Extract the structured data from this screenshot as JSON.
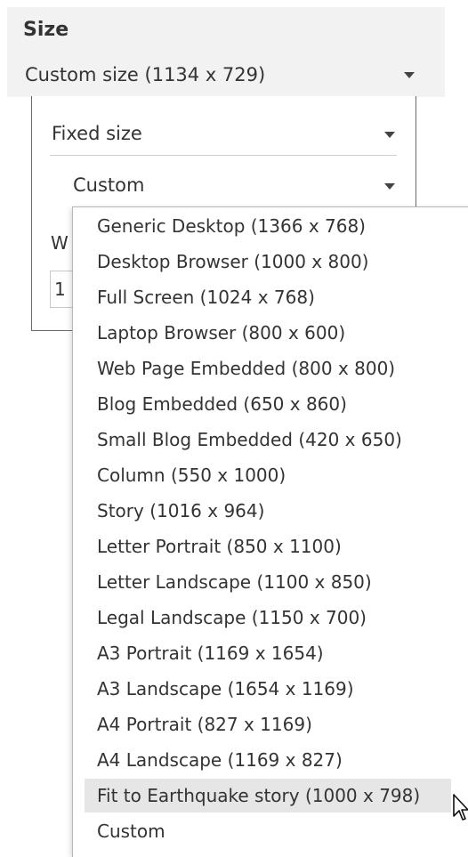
{
  "size_panel": {
    "title": "Size",
    "size_select_value": "Custom size (1134 x 729)"
  },
  "inner": {
    "mode_value": "Fixed size",
    "preset_value": "Custom",
    "width_label_partial": "W",
    "width_value_partial": "1"
  },
  "dropdown": {
    "items": [
      "Generic Desktop (1366 x 768)",
      "Desktop Browser (1000 x 800)",
      "Full Screen (1024 x 768)",
      "Laptop Browser (800 x 600)",
      "Web Page Embedded (800 x 800)",
      "Blog Embedded (650 x 860)",
      "Small Blog Embedded (420 x 650)",
      "Column (550 x 1000)",
      "Story (1016 x 964)",
      "Letter Portrait (850 x 1100)",
      "Letter Landscape (1100 x 850)",
      "Legal Landscape (1150 x 700)",
      "A3 Portrait (1169 x 1654)",
      "A3 Landscape (1654 x 1169)",
      "A4 Portrait (827 x 1169)",
      "A4 Landscape (1169 x 827)",
      "Fit to Earthquake story (1000 x 798)",
      "Custom"
    ],
    "highlighted_index": 16
  },
  "icons": {
    "dropdown_arrow": "caret-down-icon",
    "pointer": "mouse-pointer-icon"
  },
  "colors": {
    "panel_background": "#f2f2f2",
    "highlight": "#e6e6e6",
    "text": "#333333"
  }
}
